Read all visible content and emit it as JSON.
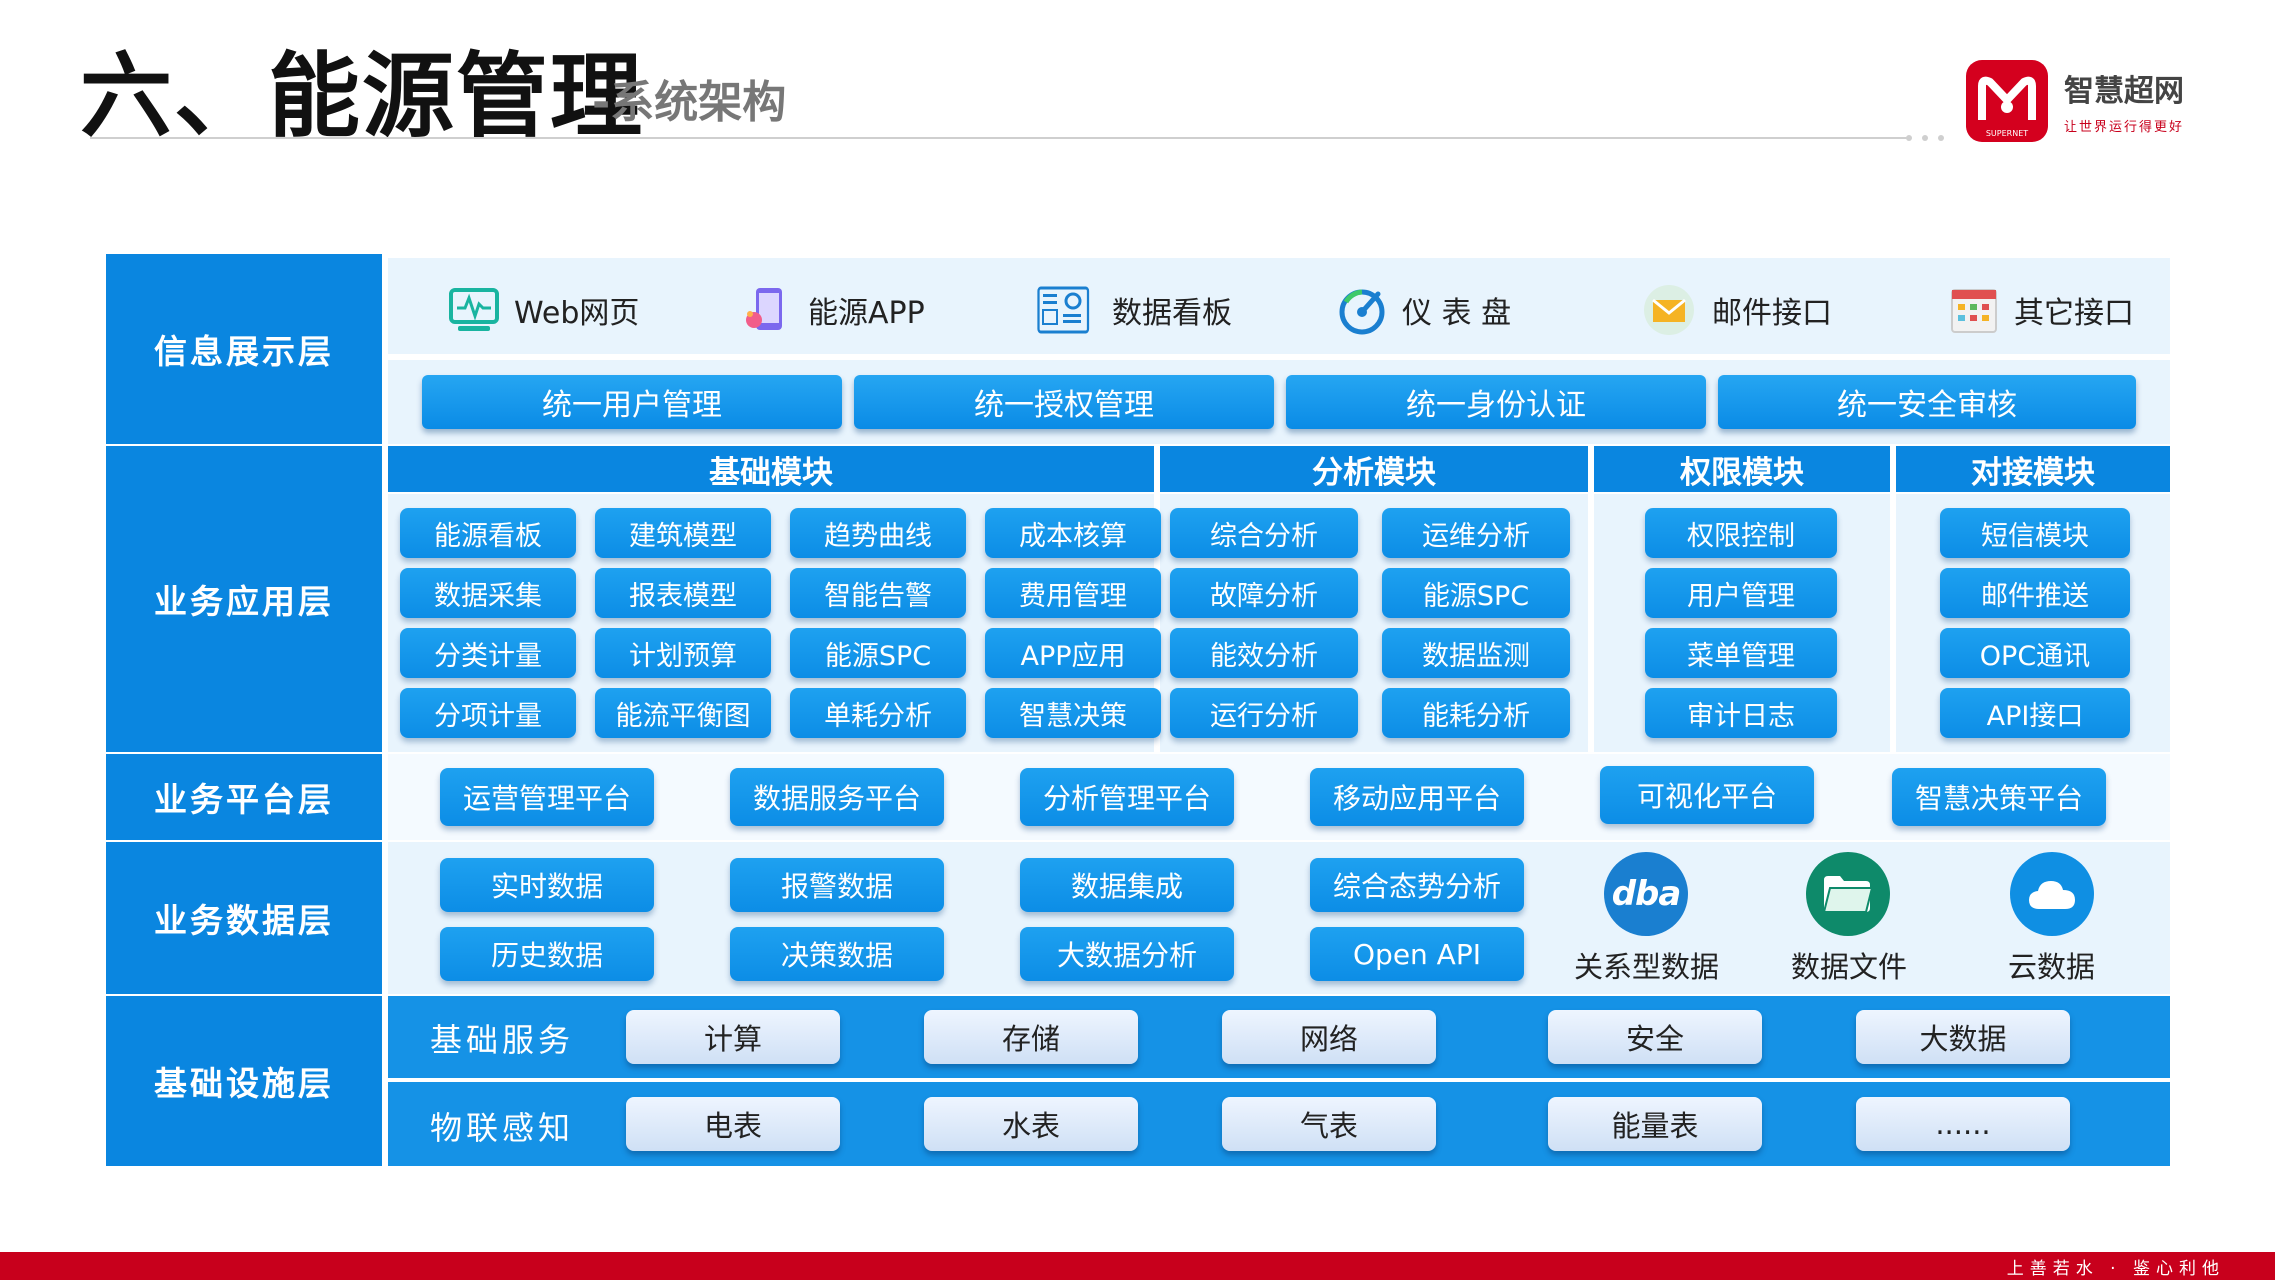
{
  "header": {
    "title": "六、能源管理",
    "subtitle": "-系统架构",
    "logo_name": "智慧超网",
    "logo_slogan": "让世界运行得更好",
    "logo_badge_text": "SUPERNET"
  },
  "colors": {
    "brand_red": "#c8001c",
    "layer_blue": "#0a86e0",
    "button_blue": "#1592e6",
    "panel_light": "#e8f4fd"
  },
  "layers": {
    "display": "信息展示层",
    "application": "业务应用层",
    "platform": "业务平台层",
    "data": "业务数据层",
    "infrastructure": "基础设施层"
  },
  "display_items": [
    {
      "label": "Web网页",
      "icon": "monitor-icon"
    },
    {
      "label": "能源APP",
      "icon": "mobile-app-icon"
    },
    {
      "label": "数据看板",
      "icon": "dashboard-board-icon"
    },
    {
      "label": "仪 表 盘",
      "icon": "gauge-icon"
    },
    {
      "label": "邮件接口",
      "icon": "mail-icon"
    },
    {
      "label": "其它接口",
      "icon": "calendar-grid-icon"
    }
  ],
  "unified": [
    "统一用户管理",
    "统一授权管理",
    "统一身份认证",
    "统一安全审核"
  ],
  "modules": {
    "basic": {
      "title": "基础模块",
      "items": [
        "能源看板",
        "建筑模型",
        "趋势曲线",
        "成本核算",
        "数据采集",
        "报表模型",
        "智能告警",
        "费用管理",
        "分类计量",
        "计划预算",
        "能源SPC",
        "APP应用",
        "分项计量",
        "能流平衡图",
        "单耗分析",
        "智慧决策"
      ]
    },
    "analysis": {
      "title": "分析模块",
      "items": [
        "综合分析",
        "运维分析",
        "故障分析",
        "能源SPC",
        "能效分析",
        "数据监测",
        "运行分析",
        "能耗分析"
      ]
    },
    "permission": {
      "title": "权限模块",
      "items": [
        "权限控制",
        "用户管理",
        "菜单管理",
        "审计日志"
      ]
    },
    "docking": {
      "title": "对接模块",
      "items": [
        "短信模块",
        "邮件推送",
        "OPC通讯",
        "API接口"
      ]
    }
  },
  "platforms": [
    "运营管理平台",
    "数据服务平台",
    "分析管理平台",
    "移动应用平台",
    "可视化平台",
    "智慧决策平台"
  ],
  "data_layer": {
    "row1": [
      "实时数据",
      "报警数据",
      "数据集成",
      "综合态势分析"
    ],
    "row2": [
      "历史数据",
      "决策数据",
      "大数据分析",
      "Open API"
    ],
    "stores": [
      {
        "label": "关系型数据",
        "icon": "dba-database-icon",
        "badge": "dba"
      },
      {
        "label": "数据文件",
        "icon": "folder-icon"
      },
      {
        "label": "云数据",
        "icon": "cloud-icon"
      }
    ]
  },
  "infra": {
    "services_label": "基础服务",
    "services": [
      "计算",
      "存储",
      "网络",
      "安全",
      "大数据"
    ],
    "iot_label": "物联感知",
    "iot": [
      "电表",
      "水表",
      "气表",
      "能量表",
      "......"
    ]
  },
  "footer": {
    "motto": "上善若水 · 鉴心利他"
  }
}
